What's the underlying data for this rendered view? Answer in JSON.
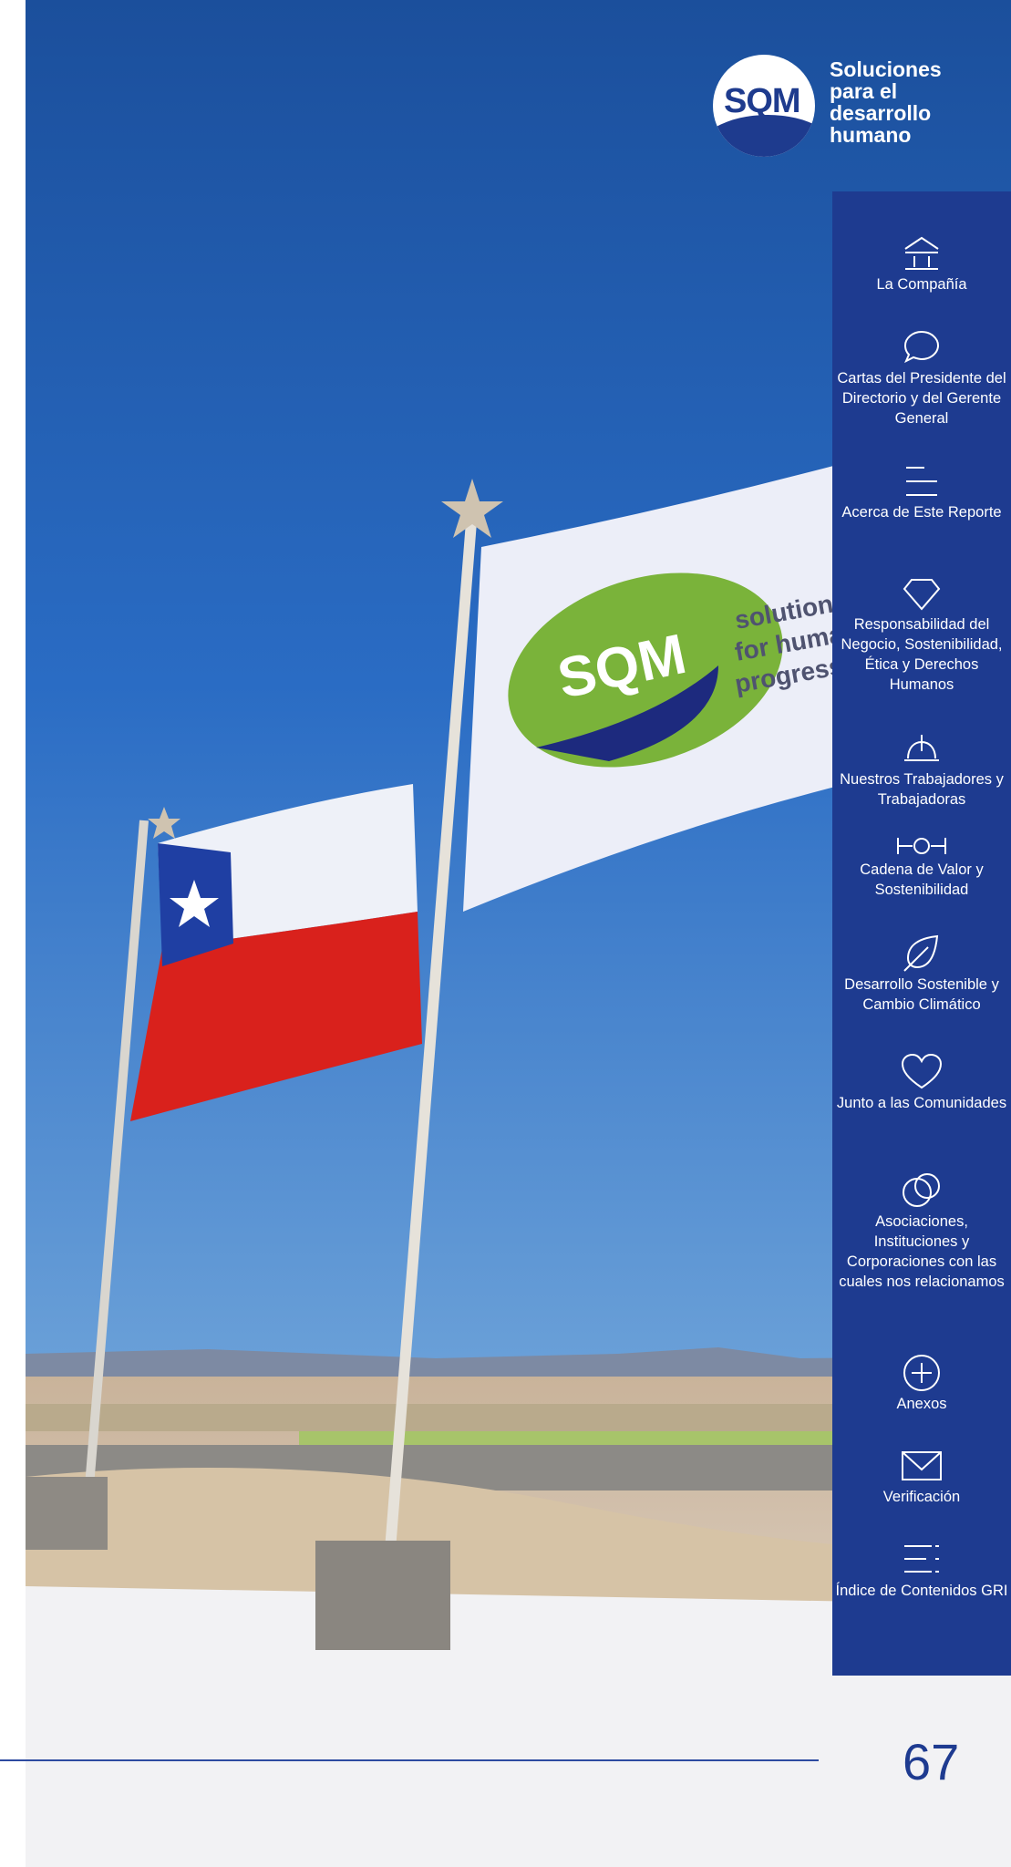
{
  "header": {
    "logo_text": "SQM",
    "tagline": [
      "Soluciones",
      "para el",
      "desarrollo",
      "humano"
    ]
  },
  "photo": {
    "flag_text": "SQM",
    "flag_slogan": [
      "solutions",
      "for human",
      "progress"
    ]
  },
  "sidebar": {
    "items": [
      {
        "label": "La Compañía",
        "icon": "institution-icon"
      },
      {
        "label": "Cartas del Presidente del Directorio y del Gerente General",
        "icon": "speech-bubble-icon"
      },
      {
        "label": "Acerca de Este Reporte",
        "icon": "lines-icon"
      },
      {
        "label": "Responsabilidad del Negocio, Sostenibilidad, Ética y Derechos Humanos",
        "icon": "diamond-icon"
      },
      {
        "label": "Nuestros Trabajadores y Trabajadoras",
        "icon": "helmet-icon"
      },
      {
        "label": "Cadena de Valor y Sostenibilidad",
        "icon": "chain-icon"
      },
      {
        "label": "Desarrollo Sostenible y Cambio Climático",
        "icon": "leaf-icon"
      },
      {
        "label": "Junto a las Comunidades",
        "icon": "heart-icon"
      },
      {
        "label": "Asociaciones, Instituciones y Corporaciones con las cuales nos relacionamos",
        "icon": "circles-icon"
      },
      {
        "label": "Anexos",
        "icon": "plus-circle-icon"
      },
      {
        "label": "Verificación",
        "icon": "envelope-icon"
      },
      {
        "label": "Índice de Contenidos GRI",
        "icon": "index-icon"
      }
    ]
  },
  "footer": {
    "page_number": "67"
  },
  "colors": {
    "brand_blue": "#1e3b90",
    "white": "#ffffff"
  }
}
